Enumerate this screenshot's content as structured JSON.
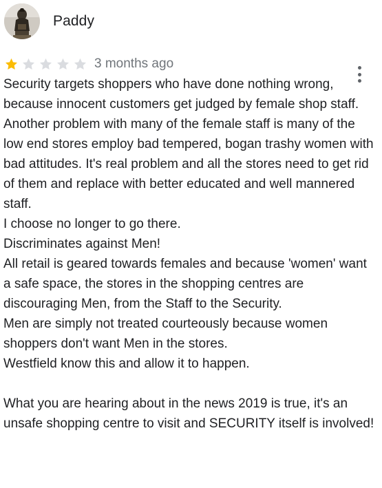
{
  "reviewer": {
    "name": "Paddy",
    "avatar_icon": "statue-photo-avatar"
  },
  "rating": {
    "stars": 1,
    "max_stars": 5,
    "filled_color": "#fbbc04",
    "empty_color": "#dadce0"
  },
  "date": "3 months ago",
  "menu": {
    "icon": "more-vertical-icon"
  },
  "review_lines": [
    "Security targets shoppers who have done nothing wrong, because innocent customers get  judged by female shop staff.",
    "Another problem with many of the female staff is many of the low end stores employ bad tempered, bogan trashy women with bad attitudes. It's real problem and all the stores need to get rid of them and replace with better educated and well mannered staff.",
    "I choose no longer to go there.",
    "Discriminates against Men!",
    "All retail is geared towards females and because 'women' want a safe space, the stores in the shopping centres are discouraging Men, from the Staff to the Security.",
    "Men are simply not treated courteously because women shoppers don't want Men in the stores.",
    "Westfield know this and allow it to happen.",
    "",
    "What you are hearing about in the news 2019 is true, it's an unsafe shopping centre to visit and SECURITY itself is involved!"
  ]
}
